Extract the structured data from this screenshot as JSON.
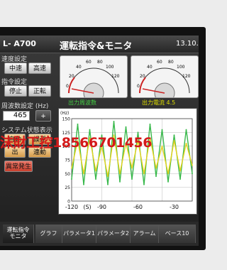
{
  "header": {
    "model": "L- A700",
    "title": "運転指令&モニタ",
    "clock": "13.10."
  },
  "left_panel": {
    "speed_group_label": "速度設定",
    "speed_buttons": [
      "中速",
      "高速"
    ],
    "command_group_label": "指令設定",
    "command_buttons": [
      "停止",
      "正転"
    ],
    "freq_group_label": "周波数設定 (Hz)",
    "freq_value": "465",
    "plus_label": "+",
    "status_group_label": "システム状態表示",
    "status_buttons": [
      "自動",
      "誤浮",
      "出",
      "連動"
    ],
    "alarm_label": "異常発生"
  },
  "gauges": [
    {
      "ticks": [
        "20",
        "40",
        "60",
        "80",
        "100",
        "120"
      ],
      "zero": "0",
      "label": "出力周波数"
    },
    {
      "ticks": [
        "20",
        "40",
        "60",
        "80",
        "100",
        "120"
      ],
      "zero": "0",
      "label": "出力電流  4.5"
    }
  ],
  "graph": {
    "unit_label": "(Hz)",
    "x_ticks": [
      "-120",
      "(S)",
      "-90",
      "-60",
      "-30"
    ],
    "y_ticks": [
      "150",
      "125",
      "100",
      "75",
      "50",
      "25",
      "0"
    ]
  },
  "tabs": [
    {
      "label": "運転指令\nモニタ"
    },
    {
      "label": "グラフ"
    },
    {
      "label": "パラメータ1"
    },
    {
      "label": "パラメータ2"
    },
    {
      "label": "アラーム"
    },
    {
      "label": "ベース10"
    }
  ],
  "watermark": "沫財工控18566701456",
  "colors": {
    "series_green": "#37b84a",
    "series_yellow": "#e6d21e",
    "accent_red": "#d41a1a"
  },
  "chart_data": {
    "type": "line",
    "x": [
      -120,
      -115,
      -110,
      -105,
      -100,
      -95,
      -90,
      -85,
      -80,
      -75,
      -70,
      -65,
      -60,
      -55,
      -50,
      -45,
      -40,
      -35,
      -30,
      -25,
      -20
    ],
    "series": [
      {
        "values": [
          40,
          140,
          30,
          130,
          40,
          120,
          30,
          145,
          35,
          135,
          40,
          125,
          30,
          140,
          45,
          130,
          35,
          120,
          40,
          130,
          50
        ]
      },
      {
        "values": [
          60,
          110,
          50,
          115,
          55,
          100,
          45,
          120,
          50,
          105,
          60,
          110,
          50,
          115,
          60,
          100,
          50,
          110,
          55,
          105,
          65
        ]
      }
    ],
    "xlim": [
      -120,
      -20
    ],
    "ylim": [
      0,
      150
    ],
    "xlabel": "(S)",
    "ylabel": "(Hz)",
    "grid": true
  }
}
